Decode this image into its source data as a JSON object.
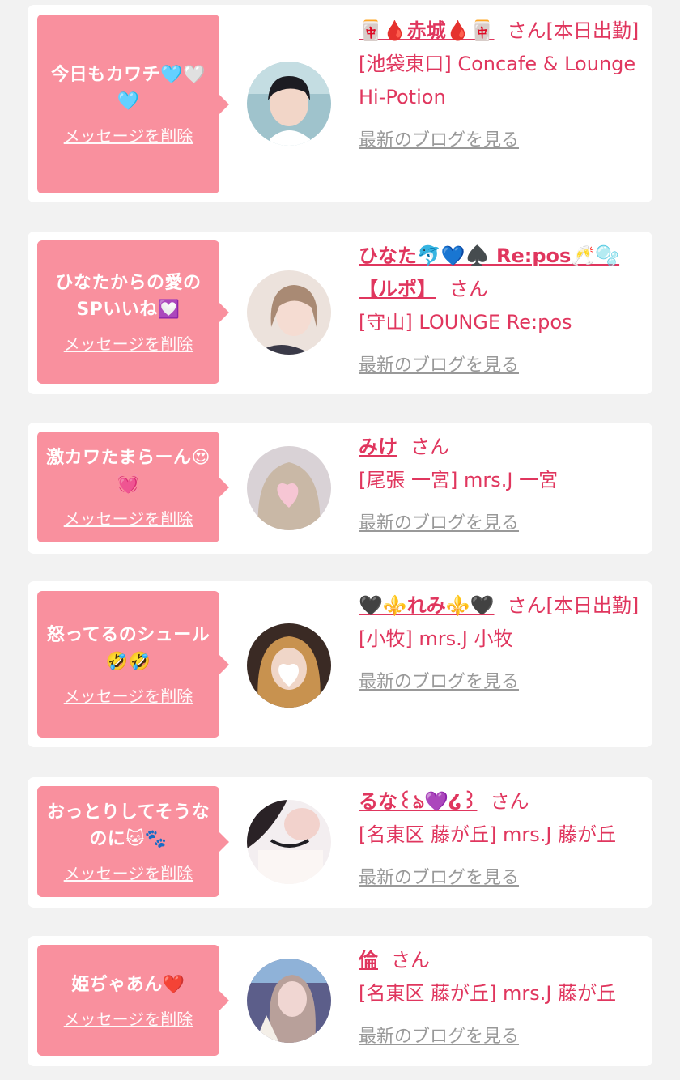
{
  "messages": [
    {
      "bubble_text": "今日もカワチ🩵🤍🩵",
      "delete_label": "メッセージを削除",
      "name": "🀄🩸赤城🩸🀄",
      "suffix": "さん[本日出勤]",
      "shop": "[池袋東口] Concafe & Lounge Hi-Potion",
      "blog_label": "最新のブログを見る",
      "avatar_icon": "profile-photo"
    },
    {
      "bubble_text": "ひなたからの愛のSPいいね💟",
      "delete_label": "メッセージを削除",
      "name": "ひなた🐬💙♠️ Re:pos🥂🫧【ルポ】",
      "suffix": "さん",
      "shop": "[守山] LOUNGE Re:pos",
      "blog_label": "最新のブログを見る",
      "avatar_icon": "profile-photo"
    },
    {
      "bubble_text": "激カワたまらーん😍💓",
      "delete_label": "メッセージを削除",
      "name": "みけ",
      "suffix": "さん",
      "shop": "[尾張 一宮] mrs.J 一宮",
      "blog_label": "最新のブログを見る",
      "avatar_icon": "profile-photo"
    },
    {
      "bubble_text": "怒ってるのシュール🤣🤣",
      "delete_label": "メッセージを削除",
      "name": "🖤⚜️れみ⚜️🖤",
      "suffix": "さん[本日出勤]",
      "shop": "[小牧] mrs.J 小牧",
      "blog_label": "最新のブログを見る",
      "avatar_icon": "profile-photo"
    },
    {
      "bubble_text": "おっとりしてそうなのに🐱🐾",
      "delete_label": "メッセージを削除",
      "name": "るな꒰ঌ💜໒꒱",
      "suffix": "さん",
      "shop": "[名東区 藤が丘] mrs.J 藤が丘",
      "blog_label": "最新のブログを見る",
      "avatar_icon": "profile-photo"
    },
    {
      "bubble_text": "姫ぢゃあん❤️",
      "delete_label": "メッセージを削除",
      "name": "倫",
      "suffix": "さん",
      "shop": "[名東区 藤が丘] mrs.J 藤が丘",
      "blog_label": "最新のブログを見る",
      "avatar_icon": "profile-photo"
    }
  ],
  "colors": {
    "page_bg": "#f2f2f2",
    "card_bg": "#ffffff",
    "bubble_bg": "#f9909e",
    "accent_text": "#e0365e",
    "muted_link": "#999999"
  }
}
